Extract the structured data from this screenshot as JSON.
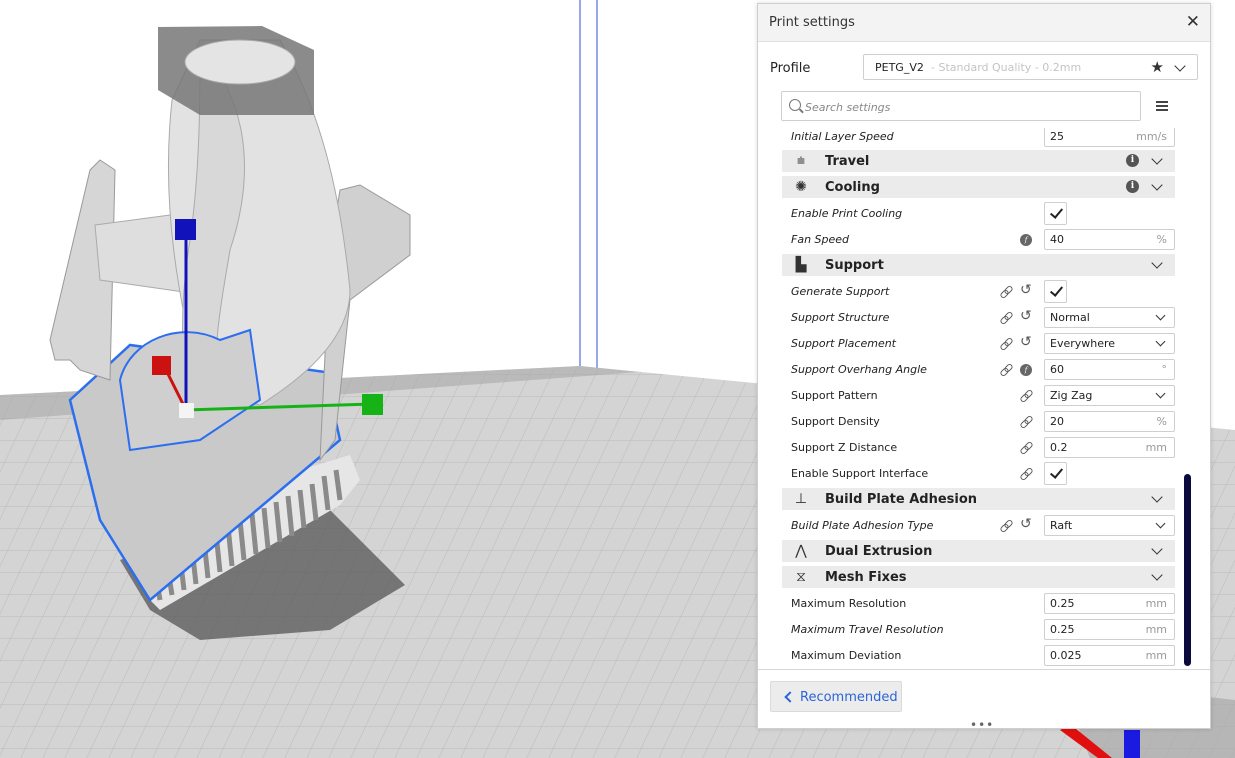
{
  "panel": {
    "title": "Print settings",
    "profile_label": "Profile",
    "profile_name": "PETG_V2",
    "profile_quality": "- Standard Quality - 0.2mm",
    "search_placeholder": "Search settings",
    "recommended_label": "Recommended",
    "resize_handle": "•••"
  },
  "settings": {
    "initial_layer_speed": {
      "label": "Initial Layer Speed",
      "value": "25",
      "unit": "mm/s"
    },
    "travel": {
      "label": "Travel"
    },
    "cooling": {
      "label": "Cooling"
    },
    "enable_print_cooling": {
      "label": "Enable Print Cooling",
      "checked": true
    },
    "fan_speed": {
      "label": "Fan Speed",
      "value": "40",
      "unit": "%"
    },
    "support": {
      "label": "Support"
    },
    "generate_support": {
      "label": "Generate Support",
      "checked": true
    },
    "support_structure": {
      "label": "Support Structure",
      "value": "Normal"
    },
    "support_placement": {
      "label": "Support Placement",
      "value": "Everywhere"
    },
    "support_overhang_angle": {
      "label": "Support Overhang Angle",
      "value": "60",
      "unit": "°"
    },
    "support_pattern": {
      "label": "Support Pattern",
      "value": "Zig Zag"
    },
    "support_density": {
      "label": "Support Density",
      "value": "20",
      "unit": "%"
    },
    "support_z_distance": {
      "label": "Support Z Distance",
      "value": "0.2",
      "unit": "mm"
    },
    "enable_support_interface": {
      "label": "Enable Support Interface",
      "checked": true
    },
    "build_plate_adhesion": {
      "label": "Build Plate Adhesion"
    },
    "build_plate_adhesion_type": {
      "label": "Build Plate Adhesion Type",
      "value": "Raft"
    },
    "dual_extrusion": {
      "label": "Dual Extrusion"
    },
    "mesh_fixes": {
      "label": "Mesh Fixes"
    },
    "maximum_resolution": {
      "label": "Maximum Resolution",
      "value": "0.25",
      "unit": "mm"
    },
    "maximum_travel_resolution": {
      "label": "Maximum Travel Resolution",
      "value": "0.25",
      "unit": "mm"
    },
    "maximum_deviation": {
      "label": "Maximum Deviation",
      "value": "0.025",
      "unit": "mm"
    }
  },
  "colors": {
    "accent": "#2a64d8",
    "scrollbar": "#0a0a3c",
    "selection_outline": "#1e6fff",
    "axis_x": "#16b316",
    "axis_y": "#cc1111",
    "axis_z": "#1212bb"
  },
  "icons": [
    "close-icon",
    "star-icon",
    "search-icon",
    "menu-icon",
    "travel-icon",
    "cooling-fan-icon",
    "support-icon",
    "build-plate-icon",
    "dual-extrusion-icon",
    "mesh-fixes-icon",
    "info-icon",
    "link-icon",
    "reset-icon",
    "function-icon",
    "chevron-down-icon",
    "chevron-left-icon"
  ]
}
